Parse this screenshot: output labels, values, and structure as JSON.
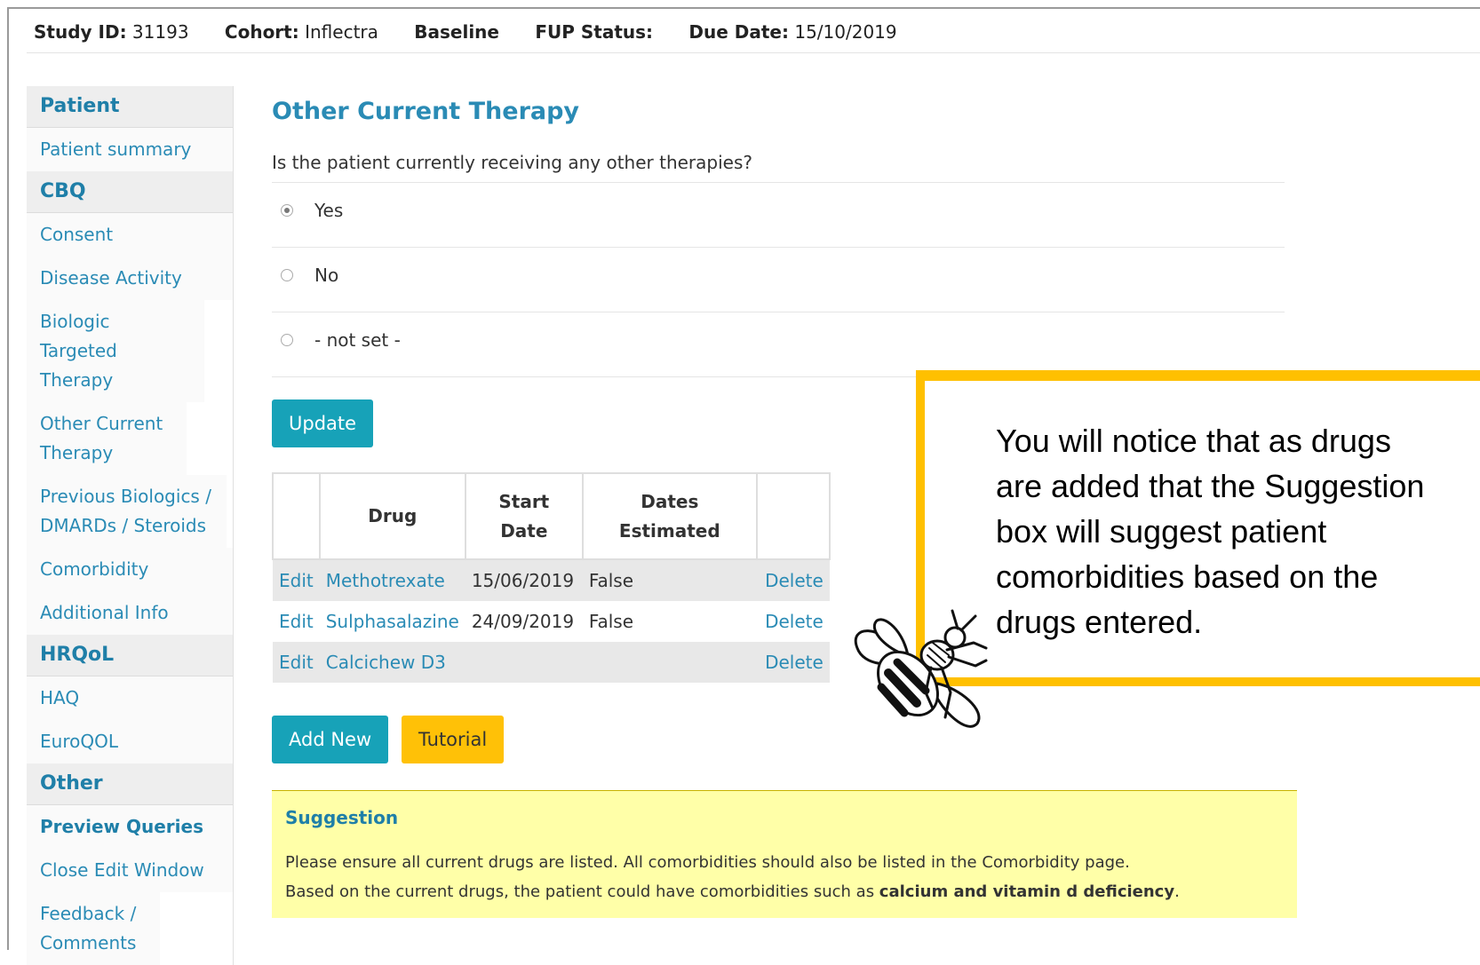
{
  "header": {
    "study_id_label": "Study ID:",
    "study_id": "31193",
    "cohort_label": "Cohort:",
    "cohort": "Inflectra",
    "baseline_label": "Baseline",
    "fup_label": "FUP Status:",
    "due_label": "Due Date:",
    "due_date": "15/10/2019"
  },
  "sidebar": {
    "patient_head": "Patient",
    "patient_summary": "Patient summary",
    "cbq_head": "CBQ",
    "consent": "Consent",
    "disease_activity": "Disease Activity",
    "biologic_targeted": "Biologic Targeted Therapy",
    "other_current": "Other Current Therapy",
    "previous_biologics": "Previous Biologics / DMARDs / Steroids",
    "comorbidity": "Comorbidity",
    "additional_info": "Additional Info",
    "hrqol_head": "HRQoL",
    "haq": "HAQ",
    "euroqol": "EuroQOL",
    "other_head": "Other",
    "preview_queries": "Preview Queries",
    "close_edit": "Close Edit Window",
    "feedback": "Feedback / Comments"
  },
  "main": {
    "title": "Other Current Therapy",
    "question": "Is the patient currently receiving any other therapies?",
    "options": [
      "Yes",
      "No",
      "- not set -"
    ],
    "selected_option": "Yes",
    "update_label": "Update",
    "table": {
      "headers": [
        "",
        "Drug",
        "Start Date",
        "Dates Estimated",
        ""
      ],
      "rows": [
        {
          "edit": "Edit",
          "drug": "Methotrexate",
          "start": "15/06/2019",
          "estimated": "False",
          "delete": "Delete"
        },
        {
          "edit": "Edit",
          "drug": "Sulphasalazine",
          "start": "24/09/2019",
          "estimated": "False",
          "delete": "Delete"
        },
        {
          "edit": "Edit",
          "drug": "Calcichew D3",
          "start": "",
          "estimated": "",
          "delete": "Delete"
        }
      ]
    },
    "add_new_label": "Add New",
    "tutorial_label": "Tutorial",
    "suggestion": {
      "title": "Suggestion",
      "line1": "Please ensure all current drugs are listed. All comorbidities should also be listed in the Comorbidity page.",
      "line2_prefix": "Based on the current drugs, the patient could have comorbidities such as ",
      "line2_bold": "calcium and vitamin d deficiency",
      "line2_suffix": "."
    }
  },
  "callout": {
    "text": "You will notice that as drugs are added that the Suggestion box will suggest patient comorbidities based on the drugs entered."
  },
  "colors": {
    "accent": "#2a8bb5",
    "button_teal": "#17a2b8",
    "button_yellow": "#ffc107",
    "callout_border": "#ffc000",
    "suggestion_bg": "#ffffa8"
  },
  "icons": {
    "mascot": "bee-icon"
  }
}
